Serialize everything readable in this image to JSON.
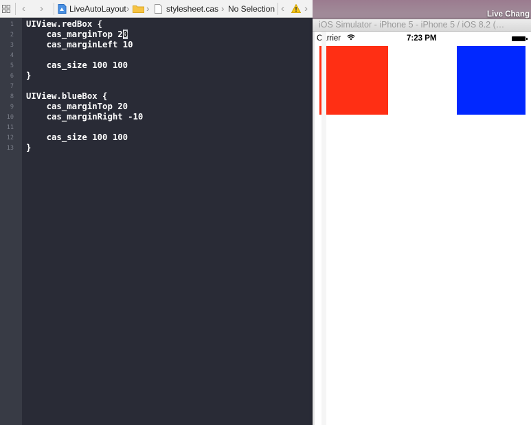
{
  "desktop": {
    "label": "Live Chang"
  },
  "jumpbar": {
    "project": "LiveAutoLayout",
    "file": "stylesheet.cas",
    "selection": "No Selection"
  },
  "editor": {
    "line_numbers": [
      "1",
      "2",
      "3",
      "4",
      "5",
      "6",
      "7",
      "8",
      "9",
      "10",
      "11",
      "12",
      "13"
    ],
    "lines": [
      "UIView.redBox {",
      "    cas_marginTop 20",
      "    cas_marginLeft 10",
      "",
      "    cas_size 100 100",
      "}",
      "",
      "UIView.blueBox {",
      "    cas_marginTop 20",
      "    cas_marginRight -10",
      "",
      "    cas_size 100 100",
      "}"
    ],
    "line2_prefix": "    cas_marginTop ",
    "line2_plain": "2",
    "line2_selected": "0"
  },
  "simulator": {
    "title": "iOS Simulator - iPhone 5 - iPhone 5 / iOS 8.2 (…",
    "carrier": "Carrier",
    "time": "7:23 PM",
    "red_box_color": "#ff2f14",
    "blue_box_color": "#0128ff"
  }
}
